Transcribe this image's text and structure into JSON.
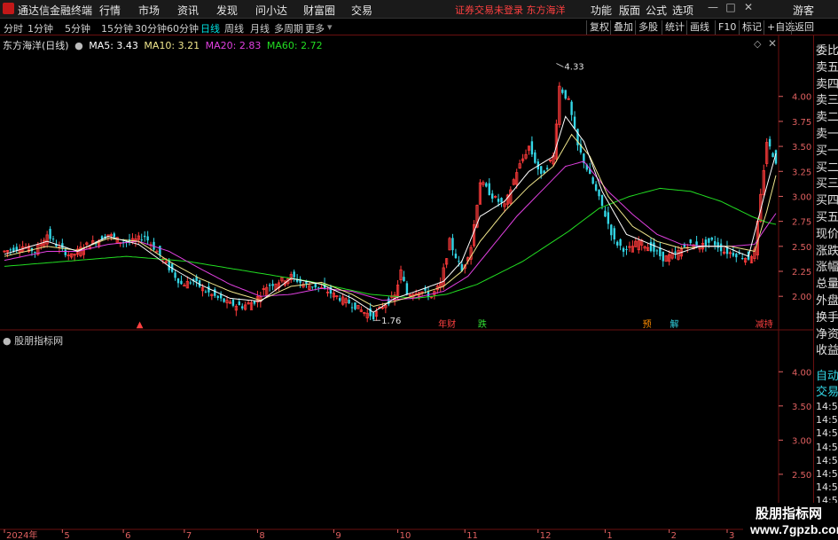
{
  "menubar": {
    "app_title": "通达信金融终端",
    "menus": [
      "行情",
      "市场",
      "资讯",
      "发现",
      "问小达",
      "财富圈",
      "交易"
    ],
    "login_status": "证券交易未登录  东方海洋",
    "right_items": [
      "功能",
      "版面",
      "公式",
      "选项"
    ],
    "user": "游客"
  },
  "toolbar": {
    "periods": [
      "分时",
      "1分钟",
      "5分钟",
      "15分钟",
      "30分钟",
      "60分钟",
      "日线",
      "周线",
      "月线",
      "多周期",
      "更多"
    ],
    "active_period": "日线",
    "tools": [
      "复权",
      "叠加",
      "多股",
      "统计",
      "画线",
      "F10",
      "标记",
      "+自选",
      "返回"
    ]
  },
  "chart_header": {
    "stock": "东方海洋(日线)",
    "ma5": "MA5: 3.43",
    "ma10": "MA10: 3.21",
    "ma20": "MA20: 2.83",
    "ma60": "MA60: 2.72"
  },
  "colors": {
    "up": "#ff3b3b",
    "down": "#33d6e6",
    "ma5": "#ffffff",
    "ma10": "#f0e68c",
    "ma20": "#e040e0",
    "ma60": "#22dd22",
    "axis_text": "#e06060",
    "frame": "#6a0f0f"
  },
  "side_panel": {
    "items": [
      "委比",
      "卖五",
      "卖四",
      "卖三",
      "卖二",
      "卖一",
      "买一",
      "买二",
      "买三",
      "买四",
      "买五",
      "现价",
      "涨跌",
      "涨幅",
      "总量",
      "外盘",
      "换手",
      "净资",
      "收益"
    ],
    "lower_items": [
      "自动",
      "交易"
    ],
    "times": [
      "14:56",
      "14:56",
      "14:56",
      "14:56",
      "14:56",
      "14:56",
      "14:56",
      "14:56",
      "14:56",
      "14:56"
    ]
  },
  "indicator": {
    "title": "股朋指标网",
    "y_ticks": [
      4.0,
      3.5,
      3.0,
      2.5,
      2.0
    ],
    "y_tick_labels": [
      "4.00",
      "3.50",
      "3.00",
      "2.50",
      "2.00"
    ]
  },
  "watermark": {
    "line1": "股朋指标网",
    "line2": "www.7gpzb.com"
  },
  "chart_data": {
    "type": "candlestick",
    "ylim": [
      1.7,
      4.45
    ],
    "y_ticks": [
      2.0,
      2.25,
      2.5,
      2.75,
      3.0,
      3.25,
      3.5,
      3.75,
      4.0
    ],
    "y_tick_labels": [
      "2.00",
      "2.25",
      "2.50",
      "2.75",
      "3.00",
      "3.25",
      "3.50",
      "3.75",
      "4.00"
    ],
    "x_axis_labels": [
      "2024年",
      "5",
      "6",
      "7",
      "8",
      "9",
      "10",
      "11",
      "12",
      "1",
      "2",
      "3"
    ],
    "x_axis_label_index": [
      0,
      19,
      39,
      59,
      83,
      108,
      129,
      151,
      175,
      197,
      218,
      237
    ],
    "annotations": [
      {
        "text": "4.33",
        "index": 181,
        "value": 4.33,
        "kind": "high"
      },
      {
        "text": "1.76",
        "index": 121,
        "value": 1.76,
        "kind": "low"
      }
    ],
    "event_markers": [
      {
        "text": "▲",
        "index": 45,
        "color": "#ff4040"
      },
      {
        "text": "年财",
        "index": 144,
        "color": "#ff4040"
      },
      {
        "text": "跌",
        "index": 157,
        "color": "#33dd33"
      },
      {
        "text": "预",
        "index": 211,
        "color": "#ff8c00"
      },
      {
        "text": "解",
        "index": 220,
        "color": "#33d6e6"
      },
      {
        "text": "减持",
        "index": 248,
        "color": "#ff4040"
      }
    ],
    "series_anchors": {
      "close": [
        [
          0,
          2.45
        ],
        [
          6,
          2.5
        ],
        [
          10,
          2.45
        ],
        [
          14,
          2.62
        ],
        [
          18,
          2.48
        ],
        [
          22,
          2.4
        ],
        [
          26,
          2.5
        ],
        [
          30,
          2.55
        ],
        [
          34,
          2.62
        ],
        [
          38,
          2.55
        ],
        [
          42,
          2.55
        ],
        [
          46,
          2.6
        ],
        [
          50,
          2.45
        ],
        [
          54,
          2.28
        ],
        [
          58,
          2.12
        ],
        [
          62,
          2.15
        ],
        [
          66,
          2.05
        ],
        [
          70,
          1.98
        ],
        [
          74,
          1.92
        ],
        [
          78,
          1.9
        ],
        [
          82,
          1.95
        ],
        [
          86,
          2.1
        ],
        [
          90,
          2.15
        ],
        [
          94,
          2.2
        ],
        [
          98,
          2.12
        ],
        [
          102,
          2.1
        ],
        [
          106,
          2.05
        ],
        [
          110,
          1.98
        ],
        [
          114,
          1.92
        ],
        [
          118,
          1.84
        ],
        [
          121,
          1.8
        ],
        [
          124,
          1.9
        ],
        [
          128,
          2.0
        ],
        [
          130,
          2.25
        ],
        [
          132,
          2.02
        ],
        [
          136,
          2.06
        ],
        [
          140,
          2.0
        ],
        [
          143,
          2.12
        ],
        [
          146,
          2.55
        ],
        [
          150,
          2.25
        ],
        [
          153,
          2.5
        ],
        [
          156,
          3.15
        ],
        [
          160,
          3.0
        ],
        [
          164,
          2.9
        ],
        [
          168,
          3.25
        ],
        [
          172,
          3.5
        ],
        [
          176,
          3.2
        ],
        [
          180,
          3.4
        ],
        [
          182,
          4.1
        ],
        [
          185,
          3.95
        ],
        [
          188,
          3.5
        ],
        [
          192,
          3.2
        ],
        [
          196,
          2.9
        ],
        [
          200,
          2.55
        ],
        [
          204,
          2.45
        ],
        [
          208,
          2.55
        ],
        [
          212,
          2.48
        ],
        [
          216,
          2.38
        ],
        [
          220,
          2.42
        ],
        [
          224,
          2.52
        ],
        [
          228,
          2.5
        ],
        [
          232,
          2.55
        ],
        [
          236,
          2.45
        ],
        [
          240,
          2.42
        ],
        [
          244,
          2.38
        ],
        [
          246,
          2.45
        ],
        [
          250,
          3.55
        ],
        [
          253,
          3.35
        ]
      ],
      "ma5": [
        [
          0,
          2.42
        ],
        [
          14,
          2.55
        ],
        [
          24,
          2.45
        ],
        [
          34,
          2.6
        ],
        [
          44,
          2.52
        ],
        [
          54,
          2.3
        ],
        [
          64,
          2.12
        ],
        [
          74,
          1.98
        ],
        [
          84,
          1.95
        ],
        [
          94,
          2.18
        ],
        [
          104,
          2.12
        ],
        [
          114,
          1.98
        ],
        [
          121,
          1.84
        ],
        [
          128,
          1.98
        ],
        [
          136,
          2.06
        ],
        [
          144,
          2.15
        ],
        [
          150,
          2.35
        ],
        [
          156,
          2.8
        ],
        [
          164,
          2.95
        ],
        [
          172,
          3.25
        ],
        [
          180,
          3.4
        ],
        [
          184,
          3.8
        ],
        [
          190,
          3.55
        ],
        [
          196,
          3.05
        ],
        [
          204,
          2.62
        ],
        [
          212,
          2.52
        ],
        [
          220,
          2.42
        ],
        [
          228,
          2.5
        ],
        [
          236,
          2.5
        ],
        [
          244,
          2.4
        ],
        [
          250,
          3.1
        ],
        [
          253,
          3.43
        ]
      ],
      "ma10": [
        [
          0,
          2.4
        ],
        [
          14,
          2.5
        ],
        [
          24,
          2.46
        ],
        [
          34,
          2.58
        ],
        [
          44,
          2.55
        ],
        [
          54,
          2.35
        ],
        [
          64,
          2.18
        ],
        [
          74,
          2.05
        ],
        [
          84,
          1.96
        ],
        [
          94,
          2.1
        ],
        [
          104,
          2.14
        ],
        [
          114,
          2.02
        ],
        [
          121,
          1.9
        ],
        [
          128,
          1.95
        ],
        [
          136,
          2.02
        ],
        [
          144,
          2.1
        ],
        [
          150,
          2.25
        ],
        [
          156,
          2.55
        ],
        [
          164,
          2.85
        ],
        [
          172,
          3.1
        ],
        [
          180,
          3.3
        ],
        [
          186,
          3.62
        ],
        [
          192,
          3.4
        ],
        [
          198,
          3.0
        ],
        [
          206,
          2.7
        ],
        [
          214,
          2.55
        ],
        [
          222,
          2.48
        ],
        [
          230,
          2.5
        ],
        [
          238,
          2.5
        ],
        [
          246,
          2.45
        ],
        [
          250,
          2.85
        ],
        [
          253,
          3.21
        ]
      ],
      "ma20": [
        [
          0,
          2.36
        ],
        [
          14,
          2.45
        ],
        [
          24,
          2.45
        ],
        [
          34,
          2.52
        ],
        [
          44,
          2.55
        ],
        [
          54,
          2.45
        ],
        [
          64,
          2.28
        ],
        [
          74,
          2.12
        ],
        [
          84,
          2.0
        ],
        [
          94,
          2.02
        ],
        [
          104,
          2.08
        ],
        [
          114,
          2.05
        ],
        [
          124,
          1.96
        ],
        [
          134,
          1.98
        ],
        [
          144,
          2.05
        ],
        [
          152,
          2.2
        ],
        [
          160,
          2.5
        ],
        [
          168,
          2.8
        ],
        [
          176,
          3.05
        ],
        [
          184,
          3.3
        ],
        [
          190,
          3.35
        ],
        [
          198,
          3.05
        ],
        [
          206,
          2.82
        ],
        [
          214,
          2.62
        ],
        [
          222,
          2.52
        ],
        [
          230,
          2.5
        ],
        [
          238,
          2.5
        ],
        [
          246,
          2.52
        ],
        [
          250,
          2.7
        ],
        [
          253,
          2.83
        ]
      ],
      "ma60": [
        [
          0,
          2.3
        ],
        [
          20,
          2.35
        ],
        [
          40,
          2.4
        ],
        [
          60,
          2.35
        ],
        [
          80,
          2.25
        ],
        [
          100,
          2.15
        ],
        [
          120,
          2.02
        ],
        [
          135,
          1.98
        ],
        [
          145,
          2.02
        ],
        [
          155,
          2.12
        ],
        [
          170,
          2.35
        ],
        [
          185,
          2.65
        ],
        [
          195,
          2.88
        ],
        [
          205,
          3.0
        ],
        [
          215,
          3.08
        ],
        [
          225,
          3.05
        ],
        [
          235,
          2.95
        ],
        [
          245,
          2.8
        ],
        [
          250,
          2.74
        ],
        [
          253,
          2.72
        ]
      ]
    }
  }
}
